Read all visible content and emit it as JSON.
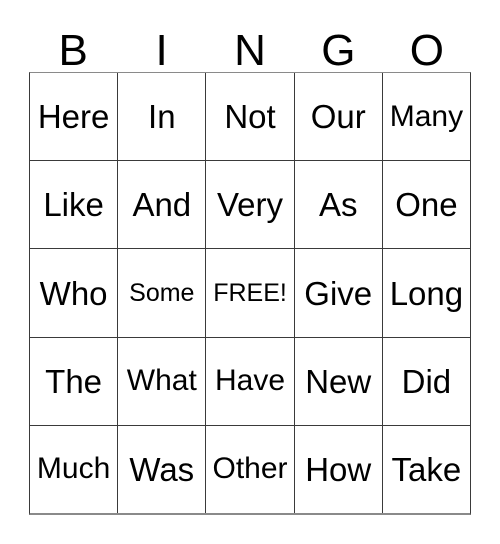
{
  "card": {
    "header_letters": [
      "B",
      "I",
      "N",
      "G",
      "O"
    ],
    "free_space_label": "FREE!",
    "colors": {
      "background": "#ffffff",
      "text": "#000000",
      "grid_line": "#3a3a3a",
      "grid_outer_line": "#8a8a8a"
    },
    "grid": {
      "columns": 5,
      "rows": 5,
      "cells": [
        [
          {
            "text": "Here",
            "fit": ""
          },
          {
            "text": "In",
            "fit": ""
          },
          {
            "text": "Not",
            "fit": ""
          },
          {
            "text": "Our",
            "fit": ""
          },
          {
            "text": "Many",
            "fit": "fit-md"
          }
        ],
        [
          {
            "text": "Like",
            "fit": ""
          },
          {
            "text": "And",
            "fit": ""
          },
          {
            "text": "Very",
            "fit": ""
          },
          {
            "text": "As",
            "fit": ""
          },
          {
            "text": "One",
            "fit": ""
          }
        ],
        [
          {
            "text": "Who",
            "fit": ""
          },
          {
            "text": "Some",
            "fit": "fit-sm"
          },
          {
            "text": "FREE!",
            "fit": "fit-sm"
          },
          {
            "text": "Give",
            "fit": ""
          },
          {
            "text": "Long",
            "fit": ""
          }
        ],
        [
          {
            "text": "The",
            "fit": ""
          },
          {
            "text": "What",
            "fit": "fit-md"
          },
          {
            "text": "Have",
            "fit": "fit-md"
          },
          {
            "text": "New",
            "fit": ""
          },
          {
            "text": "Did",
            "fit": ""
          }
        ],
        [
          {
            "text": "Much",
            "fit": "fit-md"
          },
          {
            "text": "Was",
            "fit": ""
          },
          {
            "text": "Other",
            "fit": "fit-md"
          },
          {
            "text": "How",
            "fit": ""
          },
          {
            "text": "Take",
            "fit": ""
          }
        ]
      ]
    }
  }
}
